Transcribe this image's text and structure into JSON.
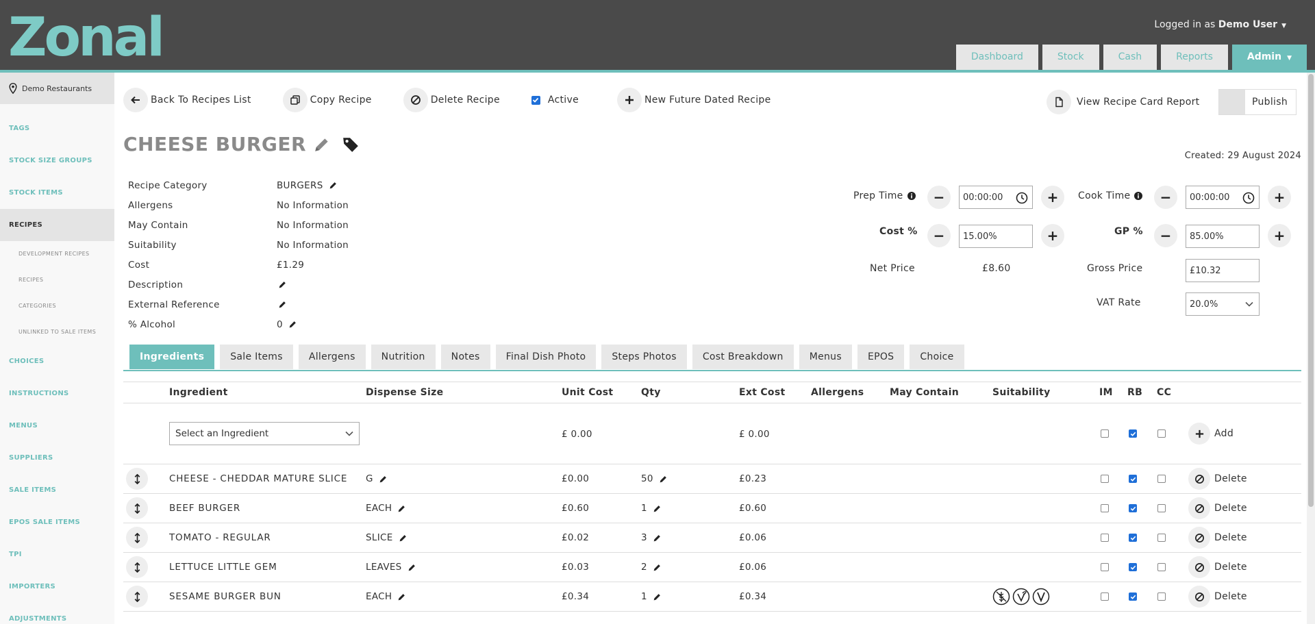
{
  "header": {
    "logo_text": "Zonal",
    "logged_in_prefix": "Logged in as",
    "user_name": "Demo User",
    "nav": [
      "Dashboard",
      "Stock",
      "Cash",
      "Reports",
      "Admin"
    ]
  },
  "sidebar": {
    "site": "Demo Restaurants",
    "items": [
      "TAGS",
      "STOCK SIZE GROUPS",
      "STOCK ITEMS",
      "RECIPES"
    ],
    "sub_items": [
      "DEVELOPMENT RECIPES",
      "RECIPES",
      "CATEGORIES",
      "UNLINKED TO SALE ITEMS"
    ],
    "items_after": [
      "CHOICES",
      "INSTRUCTIONS",
      "MENUS",
      "SUPPLIERS",
      "SALE ITEMS",
      "EPOS SALE ITEMS",
      "TPI",
      "IMPORTERS",
      "ADJUSTMENTS"
    ]
  },
  "actions": {
    "back": "Back To Recipes List",
    "copy": "Copy Recipe",
    "delete": "Delete Recipe",
    "active": "Active",
    "active_checked": true,
    "new_future": "New Future Dated Recipe",
    "report": "View Recipe Card Report",
    "publish": "Publish"
  },
  "recipe": {
    "title": "CHEESE BURGER",
    "created": "Created: 29 August 2024",
    "details": [
      {
        "label": "Recipe Category",
        "value": "BURGERS",
        "edit": true
      },
      {
        "label": "Allergens",
        "value": "No Information",
        "edit": false
      },
      {
        "label": "May Contain",
        "value": "No Information",
        "edit": false
      },
      {
        "label": "Suitability",
        "value": "No Information",
        "edit": false
      },
      {
        "label": "Cost",
        "value": "£1.29",
        "edit": false
      },
      {
        "label": "Description",
        "value": "",
        "edit": true
      },
      {
        "label": "External Reference",
        "value": "",
        "edit": true
      },
      {
        "label": "% Alcohol",
        "value": "0",
        "edit": true
      }
    ]
  },
  "pricing": {
    "prep_time_label": "Prep Time",
    "prep_time": "00:00:00",
    "cook_time_label": "Cook Time",
    "cook_time": "00:00:00",
    "cost_pct_label": "Cost %",
    "cost_pct": "15.00%",
    "gp_pct_label": "GP %",
    "gp_pct": "85.00%",
    "net_price_label": "Net Price",
    "net_price": "£8.60",
    "gross_price_label": "Gross Price",
    "gross_price": "£10.32",
    "vat_rate_label": "VAT Rate",
    "vat_rate": "20.0%"
  },
  "tabs": [
    "Ingredients",
    "Sale Items",
    "Allergens",
    "Nutrition",
    "Notes",
    "Final Dish Photo",
    "Steps Photos",
    "Cost Breakdown",
    "Menus",
    "EPOS",
    "Choice"
  ],
  "table": {
    "headers": {
      "ingredient": "Ingredient",
      "dispense": "Dispense Size",
      "unit_cost": "Unit Cost",
      "qty": "Qty",
      "ext_cost": "Ext Cost",
      "allergens": "Allergens",
      "may_contain": "May Contain",
      "suitability": "Suitability",
      "im": "IM",
      "rb": "RB",
      "cc": "CC"
    },
    "add_row": {
      "placeholder": "Select an Ingredient",
      "unit_cost": "£ 0.00",
      "ext_cost": "£ 0.00",
      "add_label": "Add"
    },
    "delete_label": "Delete",
    "rows": [
      {
        "name": "CHEESE - CHEDDAR MATURE SLICE",
        "dispense": "G",
        "unit_cost": "£0.00",
        "qty": "50",
        "ext_cost": "£0.23",
        "im": false,
        "rb": true,
        "cc": false
      },
      {
        "name": "BEEF BURGER",
        "dispense": "EACH",
        "unit_cost": "£0.60",
        "qty": "1",
        "ext_cost": "£0.60",
        "im": false,
        "rb": true,
        "cc": false
      },
      {
        "name": "TOMATO - REGULAR",
        "dispense": "SLICE",
        "unit_cost": "£0.02",
        "qty": "3",
        "ext_cost": "£0.06",
        "im": false,
        "rb": true,
        "cc": false
      },
      {
        "name": "LETTUCE LITTLE GEM",
        "dispense": "LEAVES",
        "unit_cost": "£0.03",
        "qty": "2",
        "ext_cost": "£0.06",
        "im": false,
        "rb": true,
        "cc": false
      },
      {
        "name": "SESAME BURGER BUN",
        "dispense": "EACH",
        "unit_cost": "£0.34",
        "qty": "1",
        "ext_cost": "£0.34",
        "im": false,
        "rb": true,
        "cc": false
      }
    ]
  },
  "icons": {
    "pencil": "pencil-icon",
    "tag": "tag-icon",
    "clock": "clock-icon",
    "info": "info-icon",
    "suitability": [
      "gluten-free-icon",
      "vegan-icon",
      "vegetarian-icon"
    ]
  },
  "colors": {
    "header_bg": "#4a4a4a",
    "accent": "#6ebfbb",
    "checkbox": "#1f6fd8"
  }
}
